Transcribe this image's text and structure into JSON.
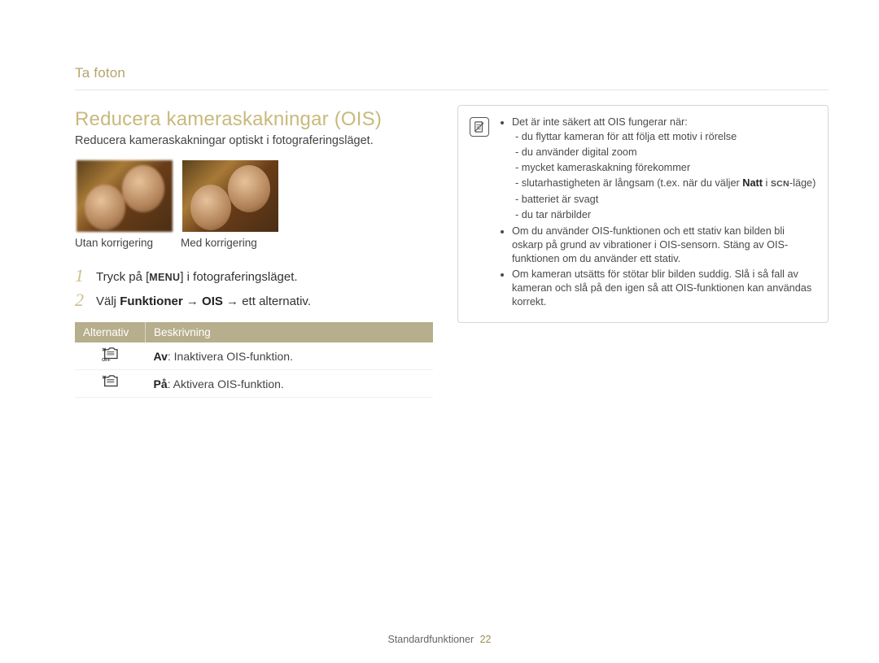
{
  "breadcrumb": "Ta foton",
  "title": "Reducera kameraskakningar (OIS)",
  "subtitle": "Reducera kameraskakningar optiskt i fotograferingsläget.",
  "photos": {
    "caption_without": "Utan korrigering",
    "caption_with": "Med korrigering"
  },
  "steps": [
    {
      "pre": "Tryck på [",
      "key": "MENU",
      "post": "] i fotograferingsläget."
    },
    {
      "pre": "Välj ",
      "bold1": "Funktioner",
      "arrow1": " → ",
      "bold2": "OIS",
      "arrow2": " → ",
      "post": "ett alternativ."
    }
  ],
  "table": {
    "head_option": "Alternativ",
    "head_desc": "Beskrivning",
    "rows": [
      {
        "icon": "ois-off-icon",
        "label": "Av",
        "desc": ": Inaktivera OIS-funktion."
      },
      {
        "icon": "ois-on-icon",
        "label": "På",
        "desc": ": Aktivera OIS-funktion."
      }
    ]
  },
  "note": {
    "intro": "Det är inte säkert att OIS fungerar när:",
    "sub": [
      "du flyttar kameran för att följa ett motiv i rörelse",
      "du använder digital zoom",
      "mycket kameraskakning förekommer",
      "slutarhastigheten är långsam (t.ex. när du väljer ",
      "batteriet är svagt",
      "du tar närbilder"
    ],
    "slow_bold": "Natt",
    "slow_in": " i ",
    "slow_scn": "SCN",
    "slow_suffix": "-läge)",
    "bullet2": "Om du använder OIS-funktionen och ett stativ kan bilden bli oskarp på grund av vibrationer i OIS-sensorn. Stäng av OIS-funktionen om du använder ett stativ.",
    "bullet3": "Om kameran utsätts för stötar blir bilden suddig. Slå i så fall av kameran och slå på den igen så att OIS-funktionen kan användas korrekt."
  },
  "footer": {
    "section": "Standardfunktioner",
    "page": "22"
  }
}
